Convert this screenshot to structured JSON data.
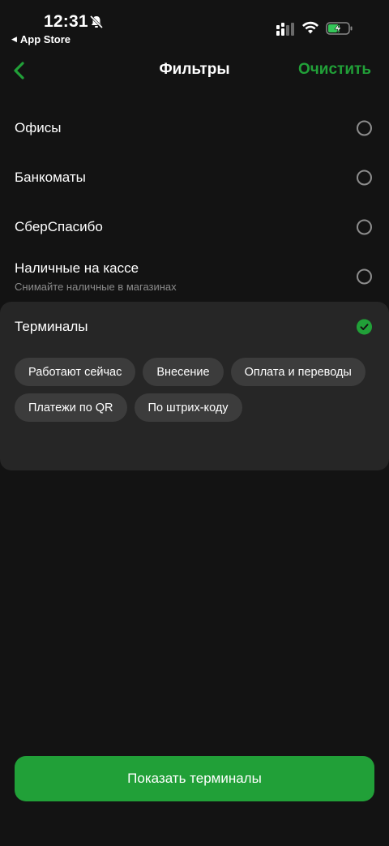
{
  "status_bar": {
    "time": "12:31",
    "back_app": "App Store",
    "icons": [
      "bell-slash-icon",
      "signal-icon",
      "wifi-icon",
      "battery-charging-icon"
    ]
  },
  "nav": {
    "title": "Фильтры",
    "clear_label": "Очистить",
    "accent_color": "#21a038"
  },
  "filters": [
    {
      "label": "Офисы",
      "sub": "",
      "checked": false
    },
    {
      "label": "Банкоматы",
      "sub": "",
      "checked": false
    },
    {
      "label": "СберСпасибо",
      "sub": "",
      "checked": false
    },
    {
      "label": "Наличные на кассе",
      "sub": "Снимайте наличные в магазинах",
      "checked": false
    },
    {
      "label": "Терминалы",
      "sub": "",
      "checked": true
    }
  ],
  "terminal_options": [
    "Работают сейчас",
    "Внесение",
    "Оплата и переводы",
    "Платежи по QR",
    "По штрих-коду"
  ],
  "show_button_label": "Показать терминалы"
}
